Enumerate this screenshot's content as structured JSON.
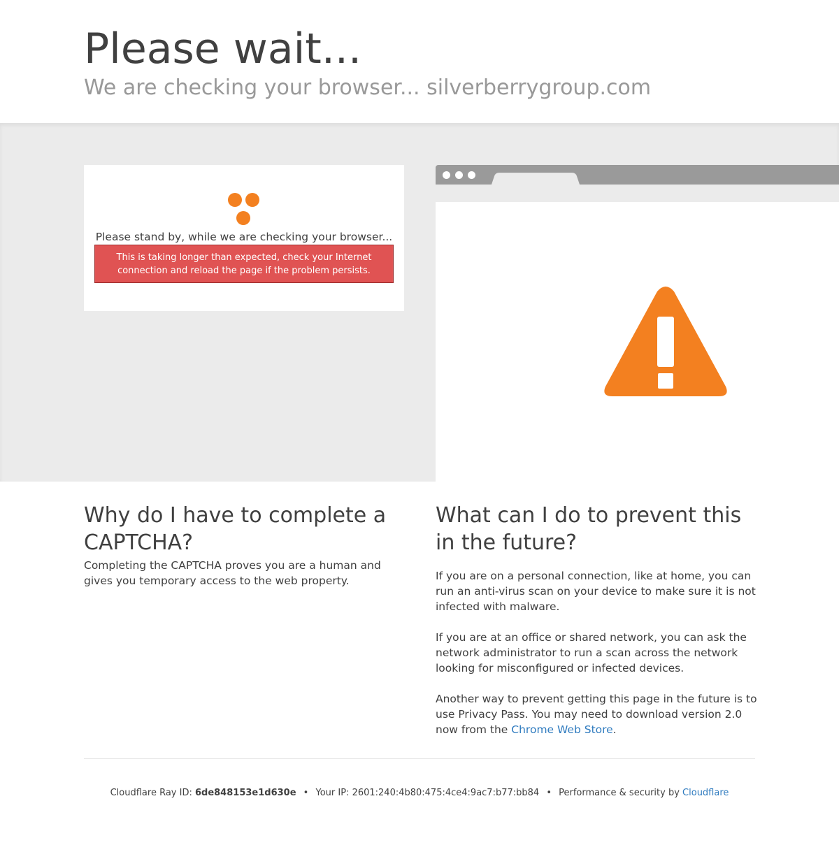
{
  "header": {
    "title": "Please wait...",
    "subtitle": "We are checking your browser... silverberrygroup.com"
  },
  "challenge": {
    "standby_text": "Please stand by, while we are checking your browser...",
    "error_text": "This is taking longer than expected, check your Internet connection and reload the page if the problem persists."
  },
  "why": {
    "heading": "Why do I have to complete a CAPTCHA?",
    "body": "Completing the CAPTCHA proves you are a human and gives you temporary access to the web property."
  },
  "prevent": {
    "heading": "What can I do to prevent this in the future?",
    "p1": "If you are on a personal connection, like at home, you can run an anti-virus scan on your device to make sure it is not infected with malware.",
    "p2": "If you are at an office or shared network, you can ask the network administrator to run a scan across the network looking for misconfigured or infected devices.",
    "p3_before": "Another way to prevent getting this page in the future is to use Privacy Pass. You may need to download version 2.0 now from the ",
    "p3_link": "Chrome Web Store",
    "p3_after": "."
  },
  "footer": {
    "ray_label": "Cloudflare Ray ID: ",
    "ray_id": "6de848153e1d630e",
    "separator": "•",
    "ip_label": "Your IP: ",
    "ip": "2601:240:4b80:475:4ce4:9ac7:b77:bb84",
    "perf_label": "Performance & security by ",
    "perf_link": "Cloudflare"
  },
  "colors": {
    "accent_orange": "#f38020",
    "error_red": "#e05353",
    "link_blue": "#2f7bbf",
    "band_gray": "#ebebeb"
  },
  "icons": [
    "loading-dots-icon",
    "warning-triangle-icon"
  ]
}
